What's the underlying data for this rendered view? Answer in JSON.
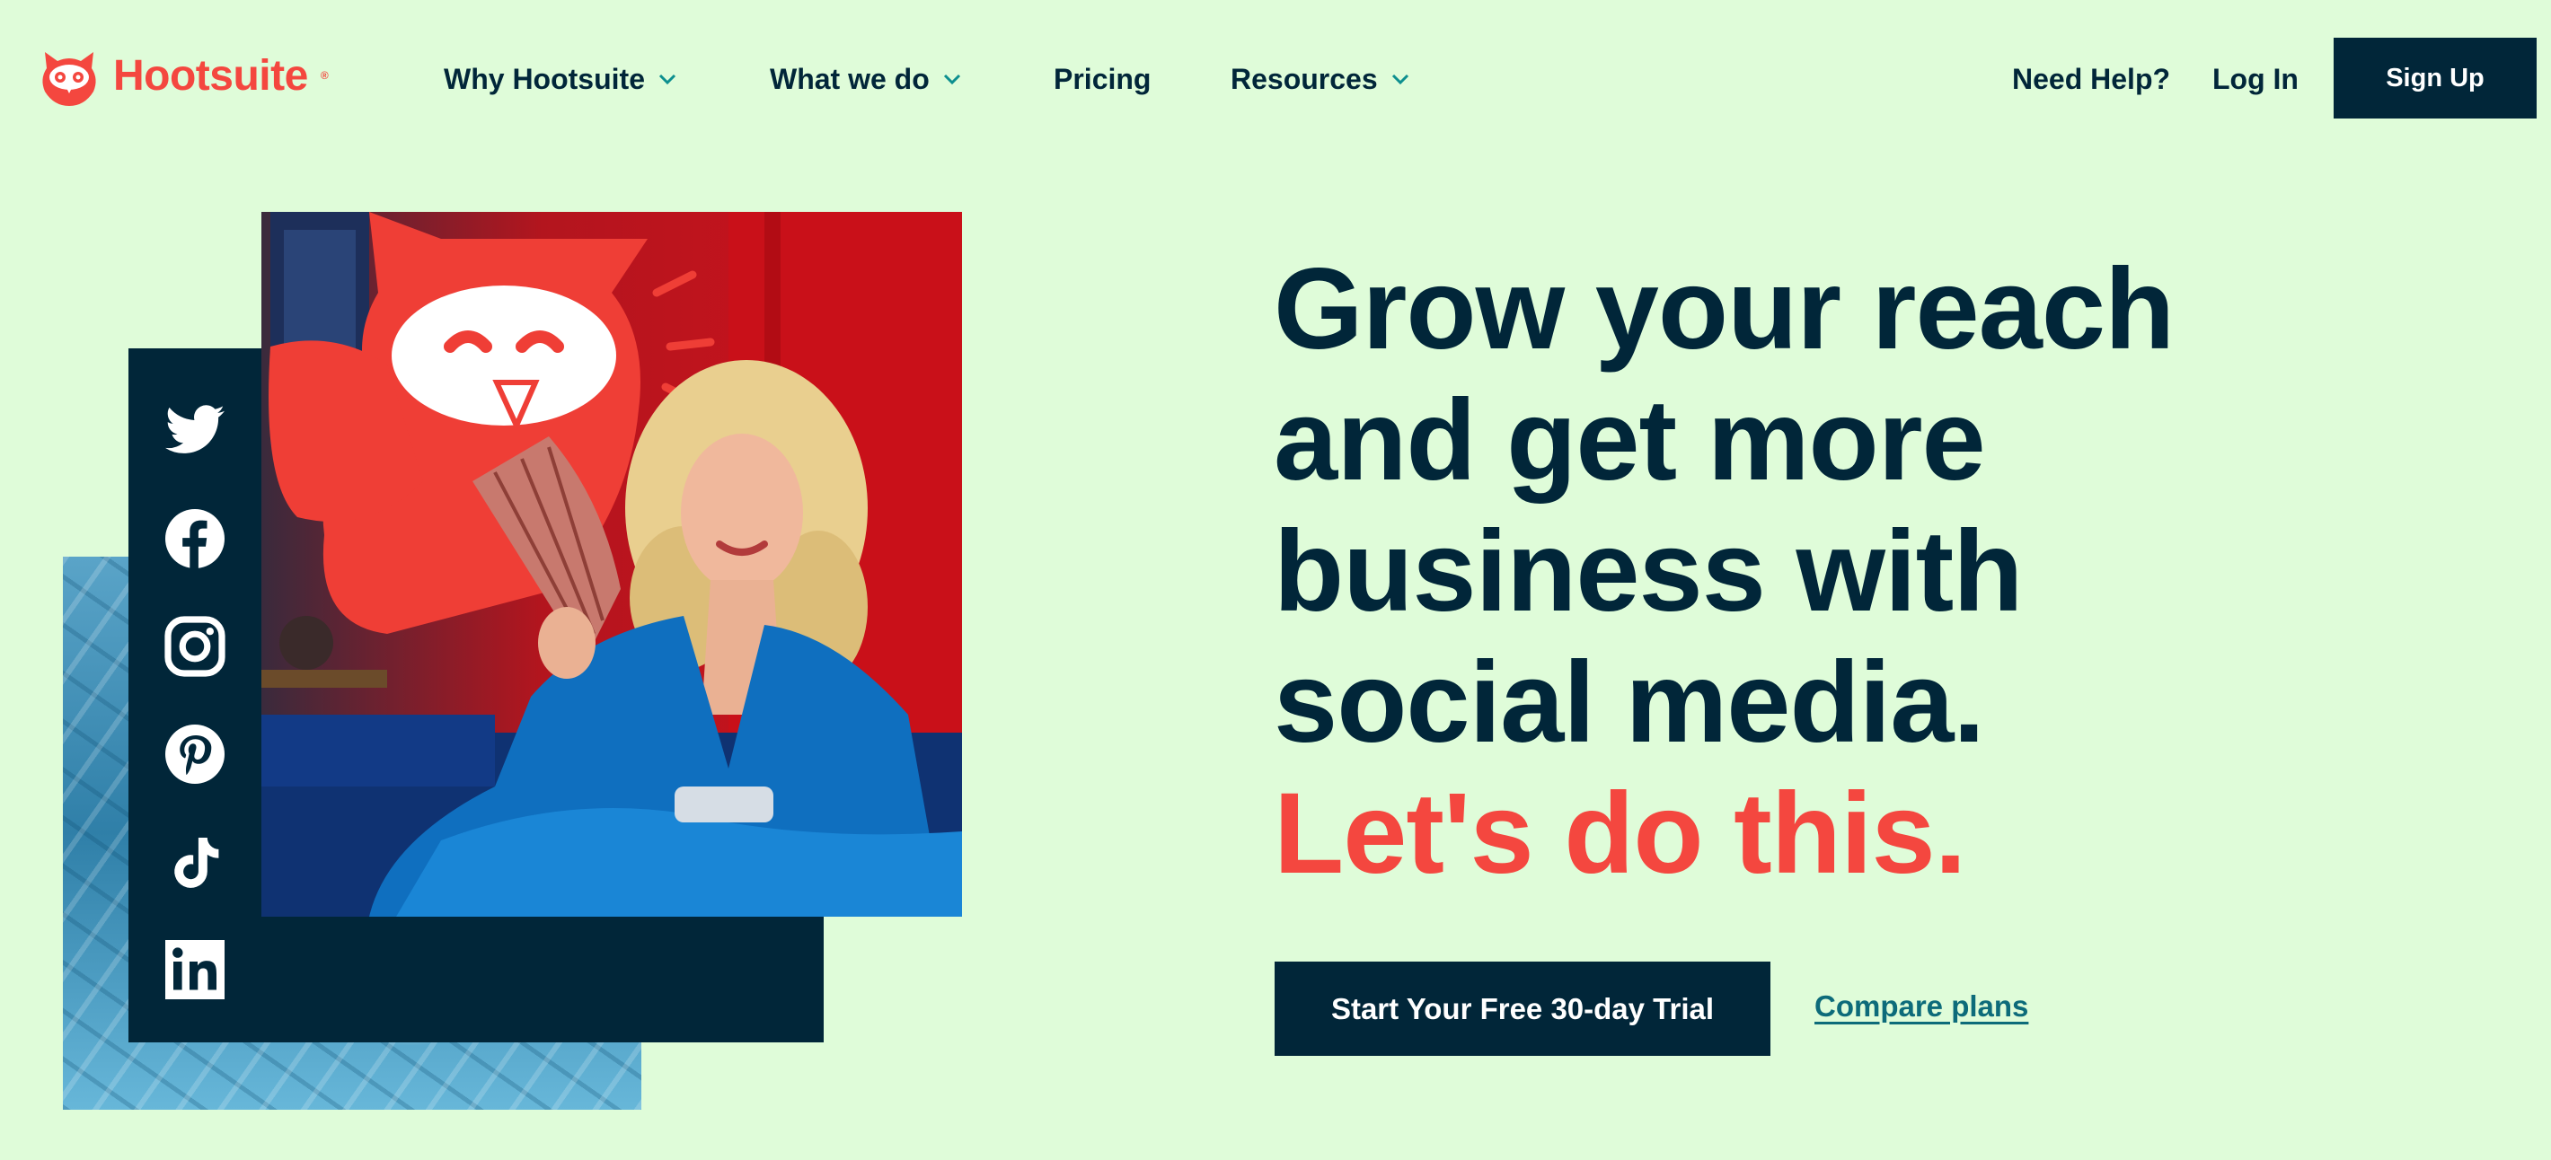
{
  "brand": {
    "name": "Hootsuite",
    "trademark": "®",
    "color": "#f4473f"
  },
  "nav": {
    "items": [
      {
        "label": "Why Hootsuite",
        "has_dropdown": true
      },
      {
        "label": "What we do",
        "has_dropdown": true
      },
      {
        "label": "Pricing",
        "has_dropdown": false
      },
      {
        "label": "Resources",
        "has_dropdown": true
      }
    ],
    "help_label": "Need Help?",
    "login_label": "Log In",
    "signup_label": "Sign Up"
  },
  "hero": {
    "headline_lines": [
      "Grow your reach",
      "and get more",
      "business with",
      "social media."
    ],
    "headline_accent": "Let's do this.",
    "primary_cta": "Start Your Free 30-day Trial",
    "secondary_cta": "Compare plans",
    "social_icons": [
      "twitter-icon",
      "facebook-icon",
      "instagram-icon",
      "pinterest-icon",
      "tiktok-icon",
      "linkedin-icon"
    ]
  },
  "colors": {
    "background": "#dffcd9",
    "navy": "#012639",
    "accent_red": "#f4473f",
    "link_teal": "#0d6b7a"
  }
}
